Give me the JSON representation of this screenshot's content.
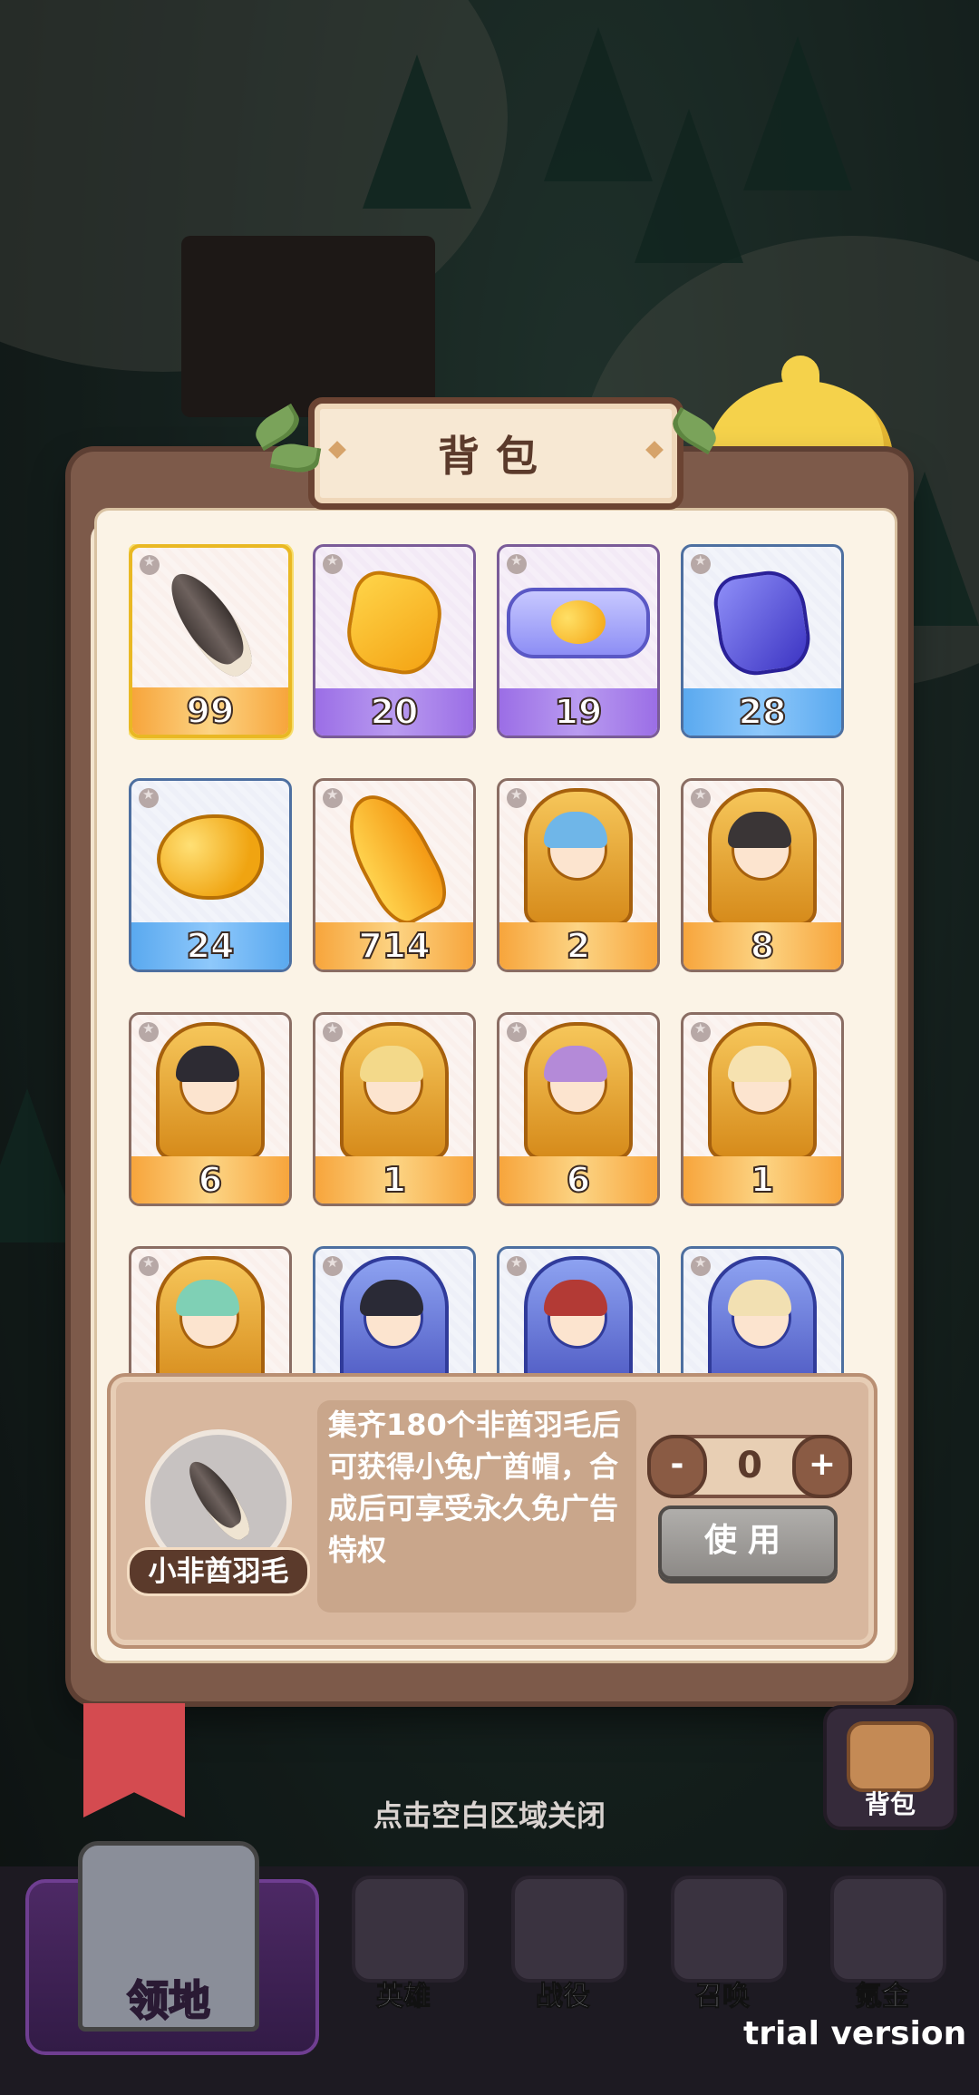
{
  "inventory": {
    "title": "背包",
    "items": [
      {
        "count": "99",
        "rarity": "orange",
        "icon": "feather-icon"
      },
      {
        "count": "20",
        "rarity": "purple",
        "icon": "gold-crystal-icon"
      },
      {
        "count": "19",
        "rarity": "purple",
        "icon": "candy-icon"
      },
      {
        "count": "28",
        "rarity": "blue",
        "icon": "blue-crystal-icon"
      },
      {
        "count": "24",
        "rarity": "blue",
        "icon": "golden-beans-icon"
      },
      {
        "count": "714",
        "rarity": "orange",
        "icon": "gold-shard-icon"
      },
      {
        "count": "2",
        "rarity": "orange",
        "icon": "hero-card-icon"
      },
      {
        "count": "8",
        "rarity": "orange",
        "icon": "hero-card-icon"
      },
      {
        "count": "6",
        "rarity": "orange",
        "icon": "hero-card-icon"
      },
      {
        "count": "1",
        "rarity": "orange",
        "icon": "hero-card-icon"
      },
      {
        "count": "6",
        "rarity": "orange",
        "icon": "hero-card-icon"
      },
      {
        "count": "1",
        "rarity": "orange",
        "icon": "hero-card-icon"
      },
      {
        "count": "",
        "rarity": "orange",
        "icon": "hero-card-icon"
      },
      {
        "count": "",
        "rarity": "blue",
        "icon": "hero-card-icon"
      },
      {
        "count": "",
        "rarity": "blue",
        "icon": "hero-card-icon"
      },
      {
        "count": "",
        "rarity": "blue",
        "icon": "hero-card-icon"
      }
    ]
  },
  "detail": {
    "name": "小非酋羽毛",
    "description": "集齐180个非酋羽毛后可获得小兔广酋帽，合成后可享受永久免广告特权",
    "quantity": "0",
    "minus_label": "-",
    "plus_label": "+",
    "use_label": "使用"
  },
  "close_hint": "点击空白区域关闭",
  "side": {
    "bag_label": "背包"
  },
  "nav": {
    "main": "领地",
    "items": [
      "英雄",
      "战役",
      "召唤",
      "氪金"
    ]
  },
  "watermark": "trial version",
  "colors": {
    "rarity_orange": "#f7a53c",
    "rarity_purple": "#9b6ee6",
    "rarity_blue": "#5aa9ef",
    "panel_brown": "#7d5a4a",
    "selected_border": "#e9b823"
  }
}
